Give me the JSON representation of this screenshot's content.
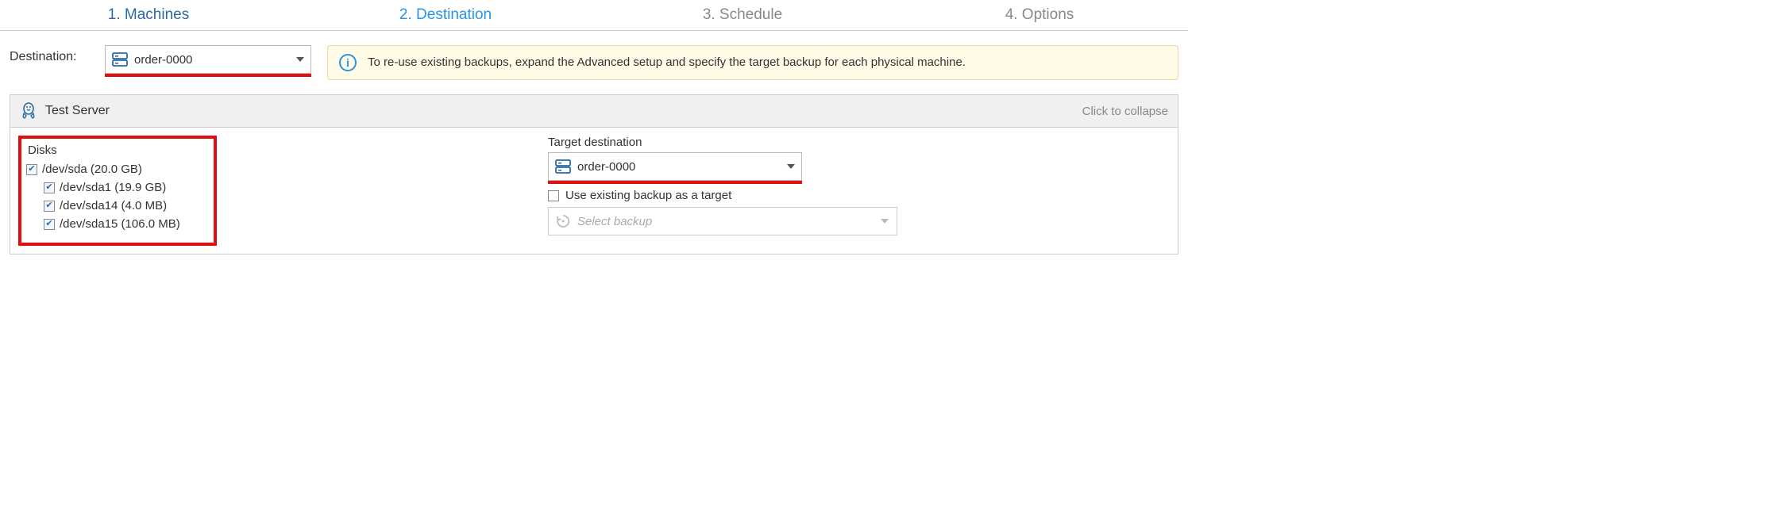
{
  "steps": {
    "s1": "1. Machines",
    "s2": "2. Destination",
    "s3": "3. Schedule",
    "s4": "4. Options"
  },
  "destination": {
    "label": "Destination:",
    "value": "order-0000"
  },
  "info": {
    "text": "To re-use existing backups, expand the Advanced setup and specify the target backup for each physical machine."
  },
  "server": {
    "name": "Test Server",
    "collapse": "Click to collapse"
  },
  "disks": {
    "title": "Disks",
    "root": "/dev/sda (20.0 GB)",
    "p1": "/dev/sda1 (19.9 GB)",
    "p2": "/dev/sda14 (4.0 MB)",
    "p3": "/dev/sda15 (106.0 MB)"
  },
  "target": {
    "label": "Target destination",
    "value": "order-0000",
    "use_existing": "Use existing backup as a target",
    "select_placeholder": "Select backup"
  }
}
